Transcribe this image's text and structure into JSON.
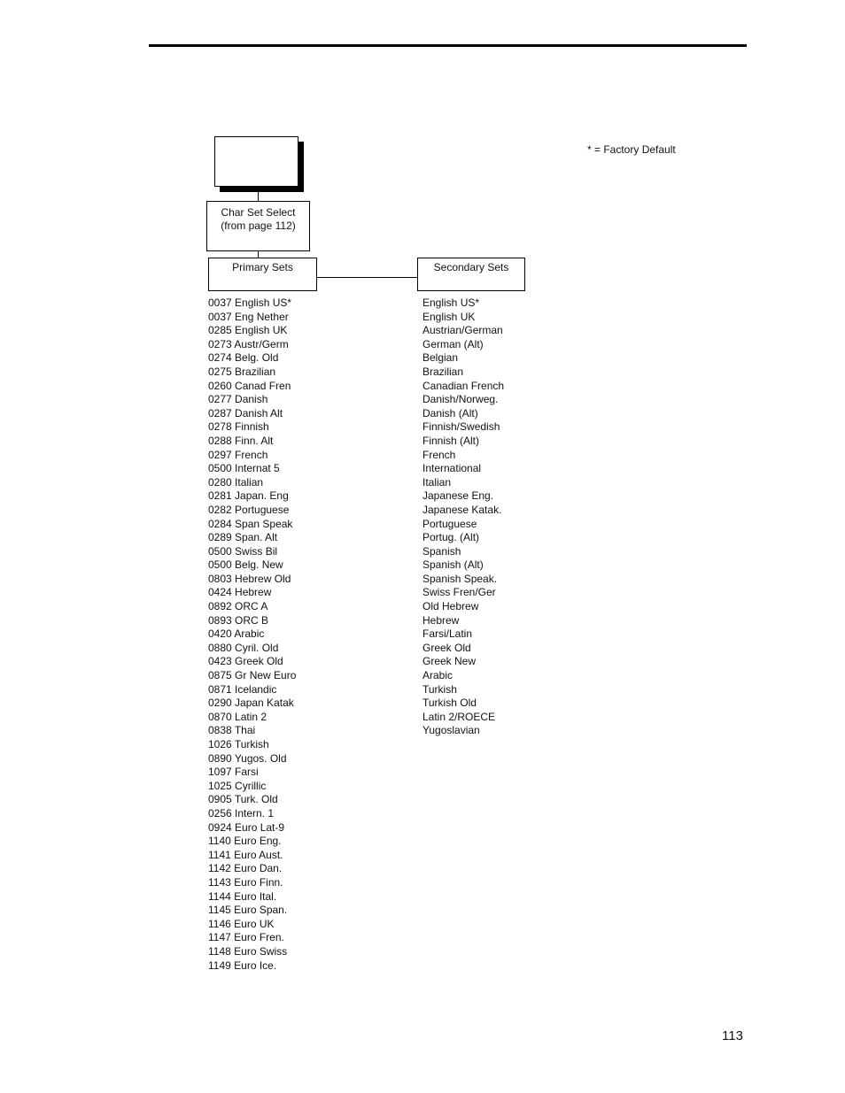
{
  "legend": "* = Factory Default",
  "diagram": {
    "menu_box_label": "",
    "char_set_select": {
      "line1": "Char Set Select",
      "line2": "(from page 112)"
    },
    "primary_label": "Primary Sets",
    "secondary_label": "Secondary Sets"
  },
  "primary_sets": [
    "0037 English US*",
    "0037 Eng Nether",
    "0285 English UK",
    "0273 Austr/Germ",
    "0274 Belg. Old",
    "0275 Brazilian",
    "0260 Canad Fren",
    "0277 Danish",
    "0287 Danish Alt",
    "0278 Finnish",
    "0288 Finn. Alt",
    "0297 French",
    "0500 Internat 5",
    "0280 Italian",
    "0281 Japan. Eng",
    "0282 Portuguese",
    "0284 Span Speak",
    "0289 Span. Alt",
    "0500 Swiss Bil",
    "0500 Belg. New",
    "0803 Hebrew Old",
    "0424 Hebrew",
    "0892 ORC A",
    "0893 ORC B",
    "0420 Arabic",
    "0880 Cyril. Old",
    "0423 Greek Old",
    "0875 Gr New Euro",
    "0871 Icelandic",
    "0290 Japan Katak",
    "0870 Latin 2",
    "0838 Thai",
    "1026 Turkish",
    "0890 Yugos. Old",
    "1097 Farsi",
    "1025 Cyrillic",
    "0905 Turk. Old",
    "0256 Intern. 1",
    "0924 Euro Lat-9",
    "1140 Euro Eng.",
    "1141 Euro Aust.",
    "1142 Euro Dan.",
    "1143 Euro Finn.",
    "1144 Euro Ital.",
    "1145 Euro Span.",
    "1146 Euro UK",
    "1147 Euro Fren.",
    "1148 Euro Swiss",
    "1149 Euro Ice."
  ],
  "secondary_sets": [
    "English US*",
    "English UK",
    "Austrian/German",
    "German (Alt)",
    "Belgian",
    "Brazilian",
    "Canadian French",
    "Danish/Norweg.",
    "Danish (Alt)",
    "Finnish/Swedish",
    "Finnish (Alt)",
    "French",
    "International",
    "Italian",
    "Japanese Eng.",
    "Japanese Katak.",
    "Portuguese",
    "Portug. (Alt)",
    "Spanish",
    "Spanish (Alt)",
    "Spanish Speak.",
    "Swiss Fren/Ger",
    "Old Hebrew",
    "Hebrew",
    "Farsi/Latin",
    "Greek Old",
    "Greek New",
    "Arabic",
    "Turkish",
    "Turkish Old",
    "Latin 2/ROECE",
    "Yugoslavian"
  ],
  "page_number": "113"
}
